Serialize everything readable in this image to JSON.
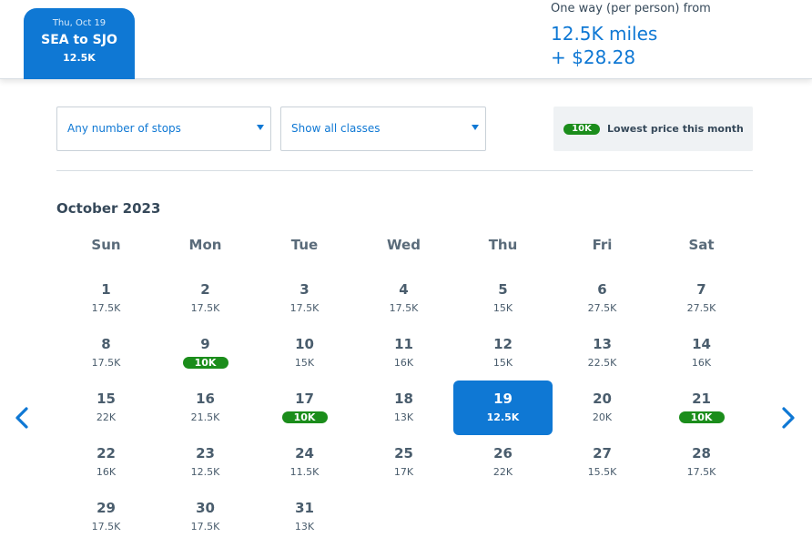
{
  "selected_flight": {
    "date": "Thu, Oct 19",
    "route": "SEA to SJO",
    "price": "12.5K"
  },
  "fare_summary": {
    "label": "One way (per person) from",
    "miles": "12.5K miles",
    "cash": "+ $28.28"
  },
  "filters": {
    "stops": "Any number of stops",
    "classes": "Show all classes"
  },
  "legend": {
    "badge": "10K",
    "text": "Lowest price this month"
  },
  "calendar": {
    "month": "October 2023",
    "weekdays": [
      "Sun",
      "Mon",
      "Tue",
      "Wed",
      "Thu",
      "Fri",
      "Sat"
    ],
    "first_weekday": 0,
    "selected_day": 19,
    "days": [
      {
        "day": "1",
        "price": "17.5K",
        "lowest": false
      },
      {
        "day": "2",
        "price": "17.5K",
        "lowest": false
      },
      {
        "day": "3",
        "price": "17.5K",
        "lowest": false
      },
      {
        "day": "4",
        "price": "17.5K",
        "lowest": false
      },
      {
        "day": "5",
        "price": "15K",
        "lowest": false
      },
      {
        "day": "6",
        "price": "27.5K",
        "lowest": false
      },
      {
        "day": "7",
        "price": "27.5K",
        "lowest": false
      },
      {
        "day": "8",
        "price": "17.5K",
        "lowest": false
      },
      {
        "day": "9",
        "price": "10K",
        "lowest": true
      },
      {
        "day": "10",
        "price": "15K",
        "lowest": false
      },
      {
        "day": "11",
        "price": "16K",
        "lowest": false
      },
      {
        "day": "12",
        "price": "15K",
        "lowest": false
      },
      {
        "day": "13",
        "price": "22.5K",
        "lowest": false
      },
      {
        "day": "14",
        "price": "16K",
        "lowest": false
      },
      {
        "day": "15",
        "price": "22K",
        "lowest": false
      },
      {
        "day": "16",
        "price": "21.5K",
        "lowest": false
      },
      {
        "day": "17",
        "price": "10K",
        "lowest": true
      },
      {
        "day": "18",
        "price": "13K",
        "lowest": false
      },
      {
        "day": "19",
        "price": "12.5K",
        "lowest": false
      },
      {
        "day": "20",
        "price": "20K",
        "lowest": false
      },
      {
        "day": "21",
        "price": "10K",
        "lowest": true
      },
      {
        "day": "22",
        "price": "16K",
        "lowest": false
      },
      {
        "day": "23",
        "price": "12.5K",
        "lowest": false
      },
      {
        "day": "24",
        "price": "11.5K",
        "lowest": false
      },
      {
        "day": "25",
        "price": "17K",
        "lowest": false
      },
      {
        "day": "26",
        "price": "22K",
        "lowest": false
      },
      {
        "day": "27",
        "price": "15.5K",
        "lowest": false
      },
      {
        "day": "28",
        "price": "17.5K",
        "lowest": false
      },
      {
        "day": "29",
        "price": "17.5K",
        "lowest": false
      },
      {
        "day": "30",
        "price": "17.5K",
        "lowest": false
      },
      {
        "day": "31",
        "price": "13K",
        "lowest": false
      }
    ]
  },
  "icons": {
    "prev": "chevron-left-icon",
    "next": "chevron-right-icon",
    "caret": "caret-down-icon"
  },
  "colors": {
    "accent": "#0f78d4",
    "lowest": "#1b8d1b"
  }
}
